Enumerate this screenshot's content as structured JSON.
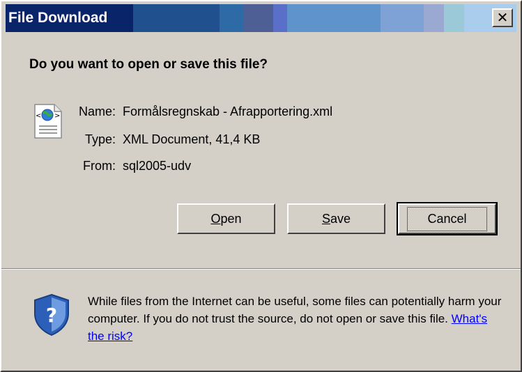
{
  "window": {
    "title": "File Download",
    "close_glyph": "✕"
  },
  "prompt": {
    "question": "Do you want to open or save this file?"
  },
  "file": {
    "icon": "xml-document-icon",
    "name_label": "Name:",
    "name_value": "Formålsregnskab - Afrapportering.xml",
    "type_label": "Type:",
    "type_value": "XML Document, 41,4 KB",
    "from_label": "From:",
    "from_value": "sql2005-udv"
  },
  "buttons": {
    "open": {
      "mnemonic": "O",
      "rest": "pen"
    },
    "save": {
      "mnemonic": "S",
      "rest": "ave"
    },
    "cancel": "Cancel"
  },
  "warning": {
    "icon": "shield-question-icon",
    "text": "While files from the Internet can be useful, some files can potentially harm your computer. If you do not trust the source, do not open or save this file. ",
    "link": "What's the risk?"
  },
  "colors": {
    "face": "#d4d0c8",
    "title_bands": [
      "#0a246a",
      "#21508e",
      "#2d6aa6",
      "#4d5f95",
      "#5a6fc8",
      "#5f93cc",
      "#7ea2d6",
      "#9aa9d2",
      "#9cc9d8",
      "#aacdee"
    ],
    "link": "#0000ff"
  }
}
